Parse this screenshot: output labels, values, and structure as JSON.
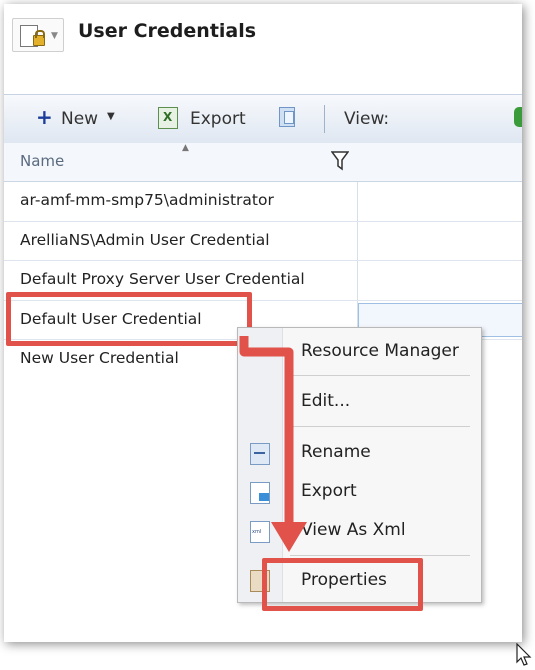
{
  "header": {
    "title": "User Credentials",
    "icon": "credential-lock-icon"
  },
  "toolbar": {
    "new_label": "New",
    "export_label": "Export",
    "view_label": "View:"
  },
  "grid": {
    "column_name": "Name",
    "rows": [
      "ar-amf-mm-smp75\\administrator",
      "ArelliaNS\\Admin User Credential",
      "Default Proxy Server User Credential",
      "Default User Credential",
      "New User Credential"
    ],
    "selected_index": 3
  },
  "context_menu": {
    "items": [
      "Resource Manager",
      "Edit...",
      "Rename",
      "Export",
      "View As Xml",
      "Properties"
    ]
  },
  "colors": {
    "highlight": "#e0524a",
    "toolbar_bg": "#dfe7f2",
    "new_plus": "#1c3d9a"
  }
}
